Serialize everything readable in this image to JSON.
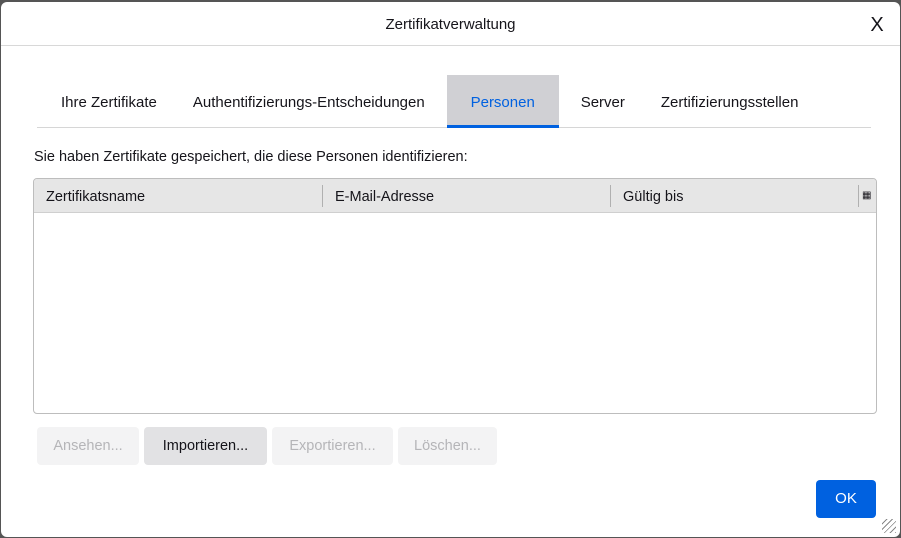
{
  "dialog": {
    "title": "Zertifikatverwaltung",
    "close_label": "X"
  },
  "tabs": [
    {
      "label": "Ihre Zertifikate"
    },
    {
      "label": "Authentifizierungs-Entscheidungen"
    },
    {
      "label": "Personen",
      "active": true
    },
    {
      "label": "Server"
    },
    {
      "label": "Zertifizierungsstellen"
    }
  ],
  "description": "Sie haben Zertifikate gespeichert, die diese Personen identifizieren:",
  "table": {
    "columns": [
      "Zertifikatsname",
      "E-Mail-Adresse",
      "Gültig bis"
    ],
    "rows": [],
    "column_picker_icon": "column-picker-icon"
  },
  "buttons": {
    "view": "Ansehen...",
    "import": "Importieren...",
    "export": "Exportieren...",
    "delete": "Löschen...",
    "ok": "OK"
  },
  "colors": {
    "accent": "#0061e0"
  }
}
